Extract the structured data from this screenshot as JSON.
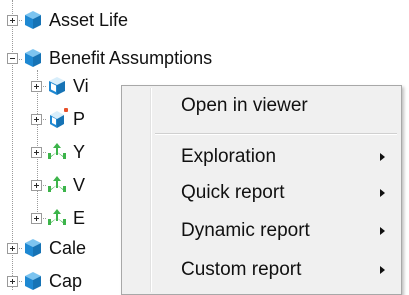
{
  "tree": {
    "items": [
      {
        "label": "Asset Life",
        "icon": "cube-blue-icon",
        "state": "collapsed"
      },
      {
        "label": "Benefit Assumptions",
        "icon": "cube-blue-icon",
        "state": "expanded"
      },
      {
        "label": "Vi",
        "icon": "cube-blue-white-icon",
        "state": "collapsed"
      },
      {
        "label": "P",
        "icon": "cube-blue-flagged-icon",
        "state": "collapsed"
      },
      {
        "label": "Y",
        "icon": "green-arrows-icon",
        "state": "collapsed"
      },
      {
        "label": "V",
        "icon": "green-arrows-icon",
        "state": "collapsed"
      },
      {
        "label": "E",
        "icon": "green-arrows-icon",
        "state": "collapsed"
      },
      {
        "label": "Cale",
        "icon": "cube-blue-icon",
        "state": "collapsed"
      },
      {
        "label": "Cap",
        "icon": "cube-blue-icon",
        "state": "collapsed"
      }
    ]
  },
  "context_menu": {
    "items": [
      {
        "label": "Open in viewer",
        "has_submenu": false
      },
      {
        "label": "Exploration",
        "has_submenu": true
      },
      {
        "label": "Quick report",
        "has_submenu": true
      },
      {
        "label": "Dynamic report",
        "has_submenu": true
      },
      {
        "label": "Custom report",
        "has_submenu": true
      }
    ]
  },
  "colors": {
    "cube_blue": "#1e88d2",
    "cube_light": "#7cc4f0",
    "arrow_green": "#3cb44a",
    "flag_red": "#e8502a",
    "menu_bg": "#f0f0f0"
  }
}
